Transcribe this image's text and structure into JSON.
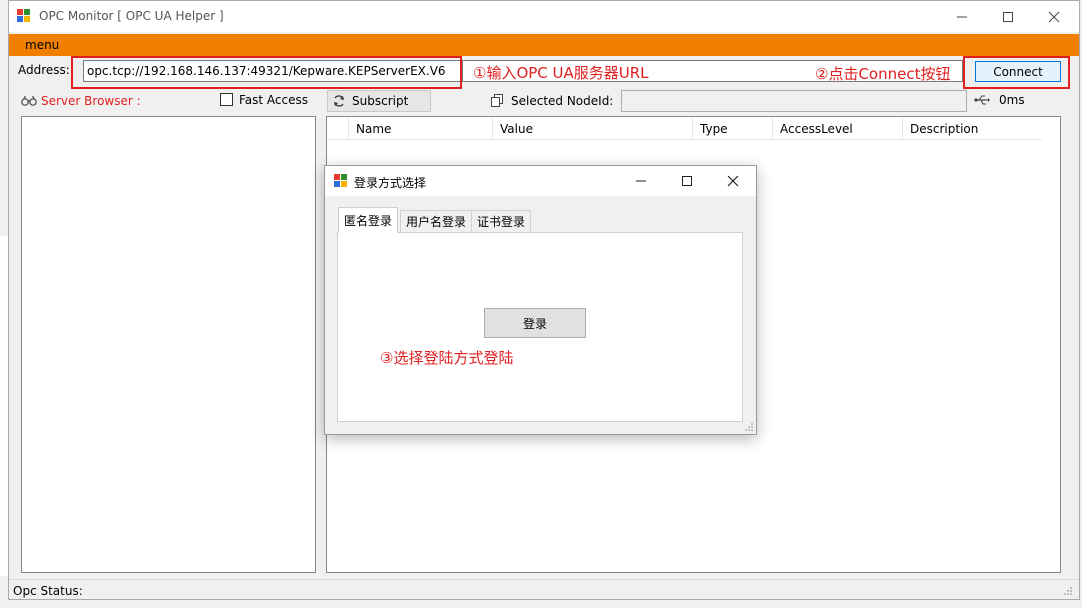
{
  "window": {
    "title": "OPC Monitor [ OPC UA Helper ]"
  },
  "menu": {
    "label": "menu"
  },
  "address": {
    "label": "Address:",
    "value": "opc.tcp://192.168.146.137:49321/Kepware.KEPServerEX.V6"
  },
  "annotations": {
    "step1": "①输入OPC UA服务器URL",
    "step2": "②点击Connect按钮",
    "step3": "③选择登陆方式登陆"
  },
  "toolbar": {
    "connect_label": "Connect",
    "server_browser_label": "Server Browser :",
    "fast_access_label": "Fast Access",
    "subscript_label": "Subscript",
    "selected_nodeid_label": "Selected NodeId:",
    "latency": "0ms"
  },
  "grid": {
    "columns": [
      "Name",
      "Value",
      "Type",
      "AccessLevel",
      "Description"
    ]
  },
  "status": {
    "label": "Opc Status:"
  },
  "dialog": {
    "title": "登录方式选择",
    "tabs": [
      "匿名登录",
      "用户名登录",
      "证书登录"
    ],
    "login_label": "登录"
  },
  "colors": {
    "menu_bar": "#f07f00",
    "annotation": "#e02020",
    "connect_border": "#0078d7"
  }
}
